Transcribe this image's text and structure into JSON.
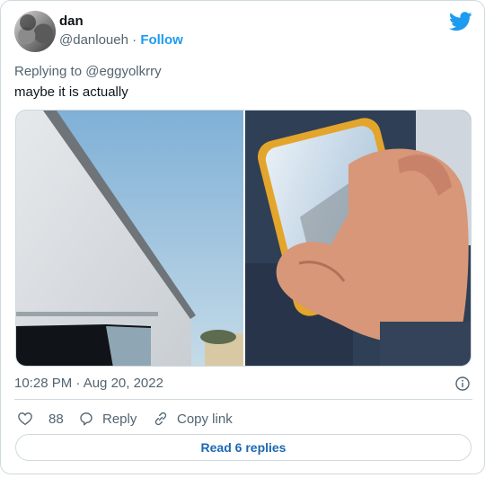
{
  "author": {
    "display_name": "dan",
    "handle": "@danloueh",
    "separator": "·",
    "follow_label": "Follow"
  },
  "tweet": {
    "replying_to": "Replying to @eggyolkrry",
    "text": "maybe it is actually",
    "timestamp": "10:28 PM · Aug 20, 2022"
  },
  "actions": {
    "like_count": "88",
    "reply_label": "Reply",
    "copy_link_label": "Copy link"
  },
  "read_replies_label": "Read 6 replies",
  "colors": {
    "brand_blue": "#1d9bf0",
    "muted_text": "#536471",
    "border": "#cfd9de"
  },
  "icons": [
    "twitter-bird-icon",
    "info-icon",
    "heart-icon",
    "reply-bubble-icon",
    "link-icon"
  ]
}
